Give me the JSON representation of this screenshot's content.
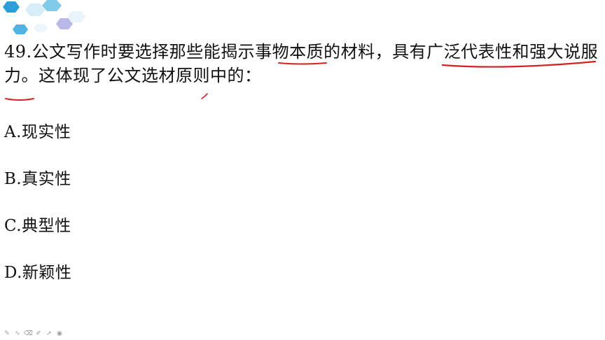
{
  "question": {
    "text": "49.公文写作时要选择那些能揭示事物本质的材料，具有广泛代表性和强大说服力。这体现了公文选材原则中的："
  },
  "options": [
    {
      "label": "A.现实性"
    },
    {
      "label": "B.真实性"
    },
    {
      "label": "C.典型性"
    },
    {
      "label": "D.新颖性"
    }
  ],
  "colors": {
    "annotation_ink": "#d42020",
    "hex_blue": "#2a9fd8",
    "hex_light": "#bfe3f5",
    "hex_purple": "#b9b8e8"
  },
  "toolbar": {
    "icons": [
      "pen-icon",
      "curve-icon",
      "eraser-icon",
      "highlighter-icon",
      "pointer-icon",
      "record-icon"
    ]
  }
}
